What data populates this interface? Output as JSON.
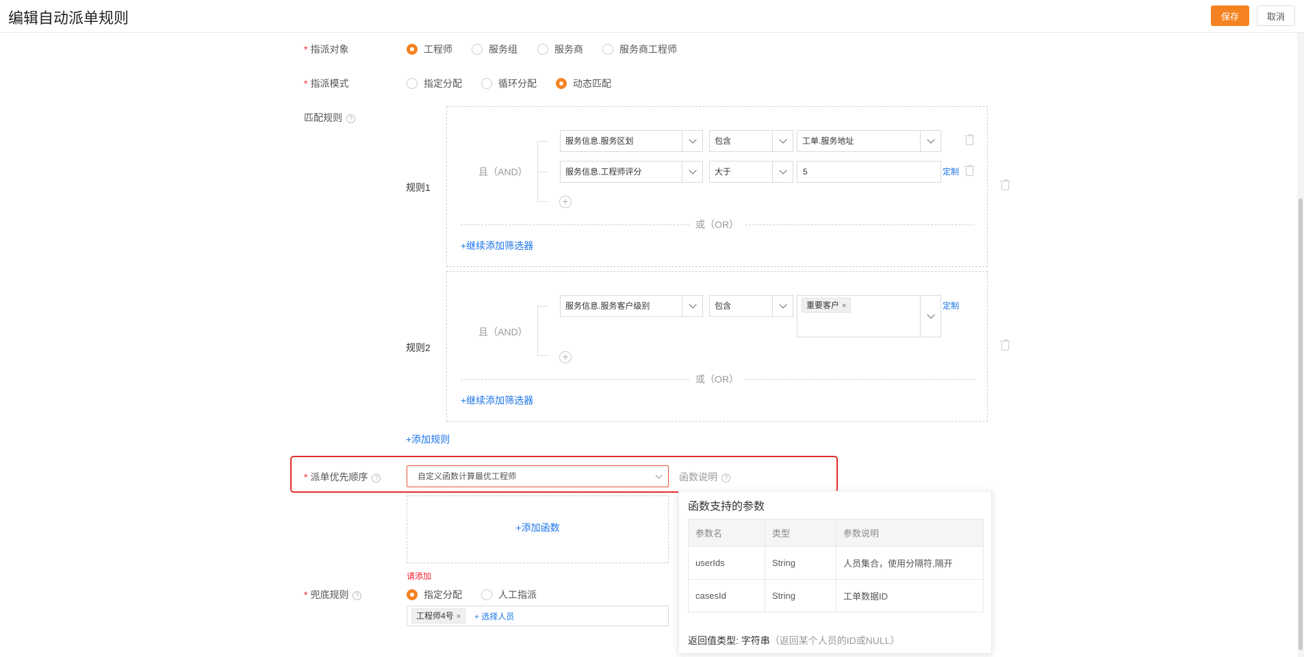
{
  "header": {
    "title": "编辑自动派单规则",
    "save_label": "保存",
    "cancel_label": "取消"
  },
  "assign_target": {
    "label": "指派对象",
    "options": [
      "工程师",
      "服务组",
      "服务商",
      "服务商工程师"
    ],
    "selected": "工程师"
  },
  "assign_mode": {
    "label": "指派模式",
    "options": [
      "指定分配",
      "循环分配",
      "动态匹配"
    ],
    "selected": "动态匹配"
  },
  "match_rules": {
    "label": "匹配规则",
    "and_label": "且（AND）",
    "or_label": "或（OR）",
    "add_filter_label": "+继续添加筛选器",
    "add_rule_label": "+添加规则",
    "custom_link": "定制",
    "rules": [
      {
        "name": "规则1",
        "conditions": [
          {
            "field": "服务信息.服务区划",
            "operator": "包含",
            "value": "工单.服务地址"
          },
          {
            "field": "服务信息.工程师评分",
            "operator": "大于",
            "value": "5"
          }
        ]
      },
      {
        "name": "规则2",
        "conditions": [
          {
            "field": "服务信息.服务客户级别",
            "operator": "包含",
            "tags": [
              "重要客户"
            ]
          }
        ]
      }
    ]
  },
  "priority": {
    "label": "派单优先顺序",
    "value": "自定义函数计算最优工程师",
    "func_desc_label": "函数说明",
    "add_function_label": "+添加函数",
    "error_text": "请添加"
  },
  "func_popover": {
    "title": "函数支持的参数",
    "columns": [
      "参数名",
      "类型",
      "参数说明"
    ],
    "rows": [
      [
        "userIds",
        "String",
        "人员集合，使用分隔符,隔开"
      ],
      [
        "casesId",
        "String",
        "工单数据ID"
      ]
    ],
    "return_label": "返回值类型:",
    "return_type": "字符串",
    "return_note": "（返回某个人员的ID或NULL）"
  },
  "fallback": {
    "label": "兜底规则",
    "options": [
      "指定分配",
      "人工指派"
    ],
    "selected": "指定分配",
    "selected_users": [
      "工程师4号"
    ],
    "add_person_label": "+ 选择人员"
  },
  "colors": {
    "primary": "#f58220",
    "link": "#1a73e8",
    "required": "#f5222d",
    "highlight": "#e32b2b"
  }
}
